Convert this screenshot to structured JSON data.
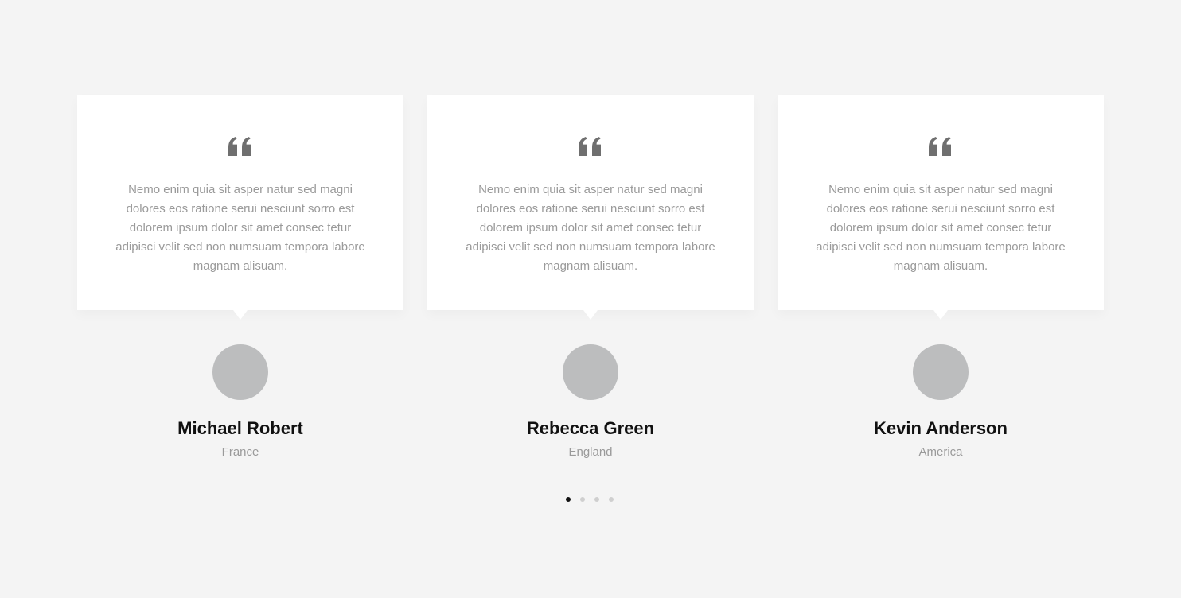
{
  "colors": {
    "page_background": "#f4f4f4",
    "card_background": "#ffffff",
    "quote_icon": "#6f6f6f",
    "body_text": "#9a9a9a",
    "name_text": "#111111",
    "avatar_placeholder": "#bcbdbe",
    "dot_active": "#111111",
    "dot_inactive": "#cfcfcf"
  },
  "testimonials": [
    {
      "quote_icon": "quote-left-icon",
      "text": "Nemo enim quia sit asper natur sed magni dolores eos ratione serui nesciunt sorro est dolorem ipsum dolor sit amet consec tetur adipisci velit sed non numsuam tempora labore magnam alisuam.",
      "name": "Michael Robert",
      "location": "France"
    },
    {
      "quote_icon": "quote-left-icon",
      "text": "Nemo enim quia sit asper natur sed magni dolores eos ratione serui nesciunt sorro est dolorem ipsum dolor sit amet consec tetur adipisci velit sed non numsuam tempora labore magnam alisuam.",
      "name": "Rebecca Green",
      "location": "England"
    },
    {
      "quote_icon": "quote-left-icon",
      "text": "Nemo enim quia sit asper natur sed magni dolores eos ratione serui nesciunt sorro est dolorem ipsum dolor sit amet consec tetur adipisci velit sed non numsuam tempora labore magnam alisuam.",
      "name": "Kevin Anderson",
      "location": "America"
    }
  ],
  "pagination": {
    "total": 4,
    "active_index": 0
  }
}
